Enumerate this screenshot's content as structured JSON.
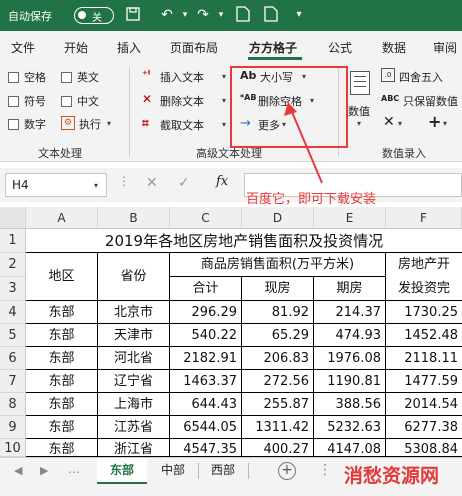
{
  "titlebar": {
    "autosave_label": "自动保存",
    "toggle_state": "关"
  },
  "tabs": [
    "文件",
    "开始",
    "插入",
    "页面布局",
    "方方格子",
    "公式",
    "数据",
    "审阅"
  ],
  "active_tab": "方方格子",
  "ribbon": {
    "text_processing": {
      "options": [
        "空格",
        "英文",
        "符号",
        "中文",
        "数字"
      ],
      "execute_label": "执行",
      "group_label": "文本处理"
    },
    "advanced_text": {
      "insert_text": "插入文本",
      "delete_text": "删除文本",
      "truncate_text": "截取文本",
      "case_label": "大小写",
      "delete_space": "删除空格",
      "more": "更多",
      "group_label": "高级文本处理"
    },
    "numeric_entry": {
      "value_label": "数值",
      "round_label": "四舍五入",
      "keep_value_label": "只保留数值",
      "group_label": "数值录入"
    }
  },
  "formula_bar": {
    "cell_ref": "H4",
    "fx": "fx",
    "value": ""
  },
  "callout": {
    "text": "百度它，即可下载安装"
  },
  "grid": {
    "columns": [
      "A",
      "B",
      "C",
      "D",
      "E",
      "F"
    ],
    "rows": [
      "1",
      "2",
      "3",
      "4",
      "5",
      "6",
      "7",
      "8",
      "9",
      "10"
    ],
    "title": "2019年各地区房地产销售面积及投资情况",
    "header_region": "地区",
    "header_province": "省份",
    "header_sales_area": "商品房销售面积(万平方米)",
    "header_total": "合计",
    "header_existing": "现房",
    "header_futures": "期房",
    "header_invest_1": "房地产开",
    "header_invest_2": "发投资完",
    "data": [
      [
        "东部",
        "北京市",
        "296.29",
        "81.92",
        "214.37",
        "1730.25"
      ],
      [
        "东部",
        "天津市",
        "540.22",
        "65.29",
        "474.93",
        "1452.48"
      ],
      [
        "东部",
        "河北省",
        "2182.91",
        "206.83",
        "1976.08",
        "2118.11"
      ],
      [
        "东部",
        "辽宁省",
        "1463.37",
        "272.56",
        "1190.81",
        "1477.59"
      ],
      [
        "东部",
        "上海市",
        "644.43",
        "255.87",
        "388.56",
        "2014.54"
      ],
      [
        "东部",
        "江苏省",
        "6544.05",
        "1311.42",
        "5232.63",
        "6277.38"
      ],
      [
        "东部",
        "浙江省",
        "4547.35",
        "400.27",
        "4147.08",
        "5308.84"
      ]
    ]
  },
  "sheets": [
    "东部",
    "中部",
    "西部"
  ],
  "active_sheet": "东部",
  "watermark": "消愁资源网",
  "colors": {
    "excel_green": "#217346",
    "callout_red": "#e83a3a"
  }
}
